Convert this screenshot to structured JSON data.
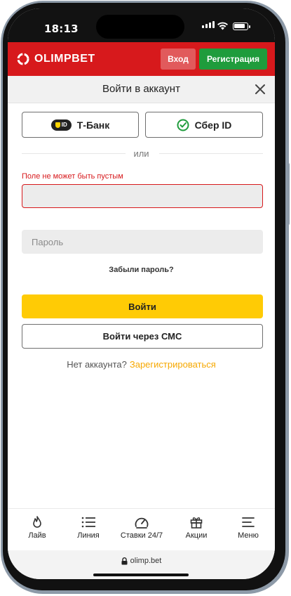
{
  "status_bar": {
    "time": "18:13"
  },
  "header": {
    "logo_text": "OLIMPBET",
    "login_label": "Вход",
    "register_label": "Регистрация",
    "brand_color": "#d7191c"
  },
  "dialog": {
    "title": "Войти в аккаунт",
    "tbank_badge": "ID",
    "tbank_label": "Т-Банк",
    "sber_label": "Сбер ID",
    "divider_text": "или",
    "error_text": "Поле не может быть пустым",
    "login_value": "",
    "password_placeholder": "Пароль",
    "forgot_label": "Забыли пароль?",
    "submit_label": "Войти",
    "sms_label": "Войти через СМС",
    "no_account_text": "Нет аккаунта?",
    "register_link": "Зарегистрироваться"
  },
  "tabbar": {
    "items": [
      {
        "label": "Лайв",
        "icon": "flame-icon"
      },
      {
        "label": "Линия",
        "icon": "list-icon"
      },
      {
        "label": "Ставки 24/7",
        "icon": "gauge-icon"
      },
      {
        "label": "Акции",
        "icon": "gift-icon"
      },
      {
        "label": "Меню",
        "icon": "menu-icon"
      }
    ]
  },
  "browser": {
    "url": "olimp.bet",
    "lock_icon": "lock-icon"
  },
  "colors": {
    "accent_yellow": "#ffcb05",
    "register_green": "#1f9c3c",
    "link_orange": "#f6a800",
    "error_red": "#d7191c"
  }
}
